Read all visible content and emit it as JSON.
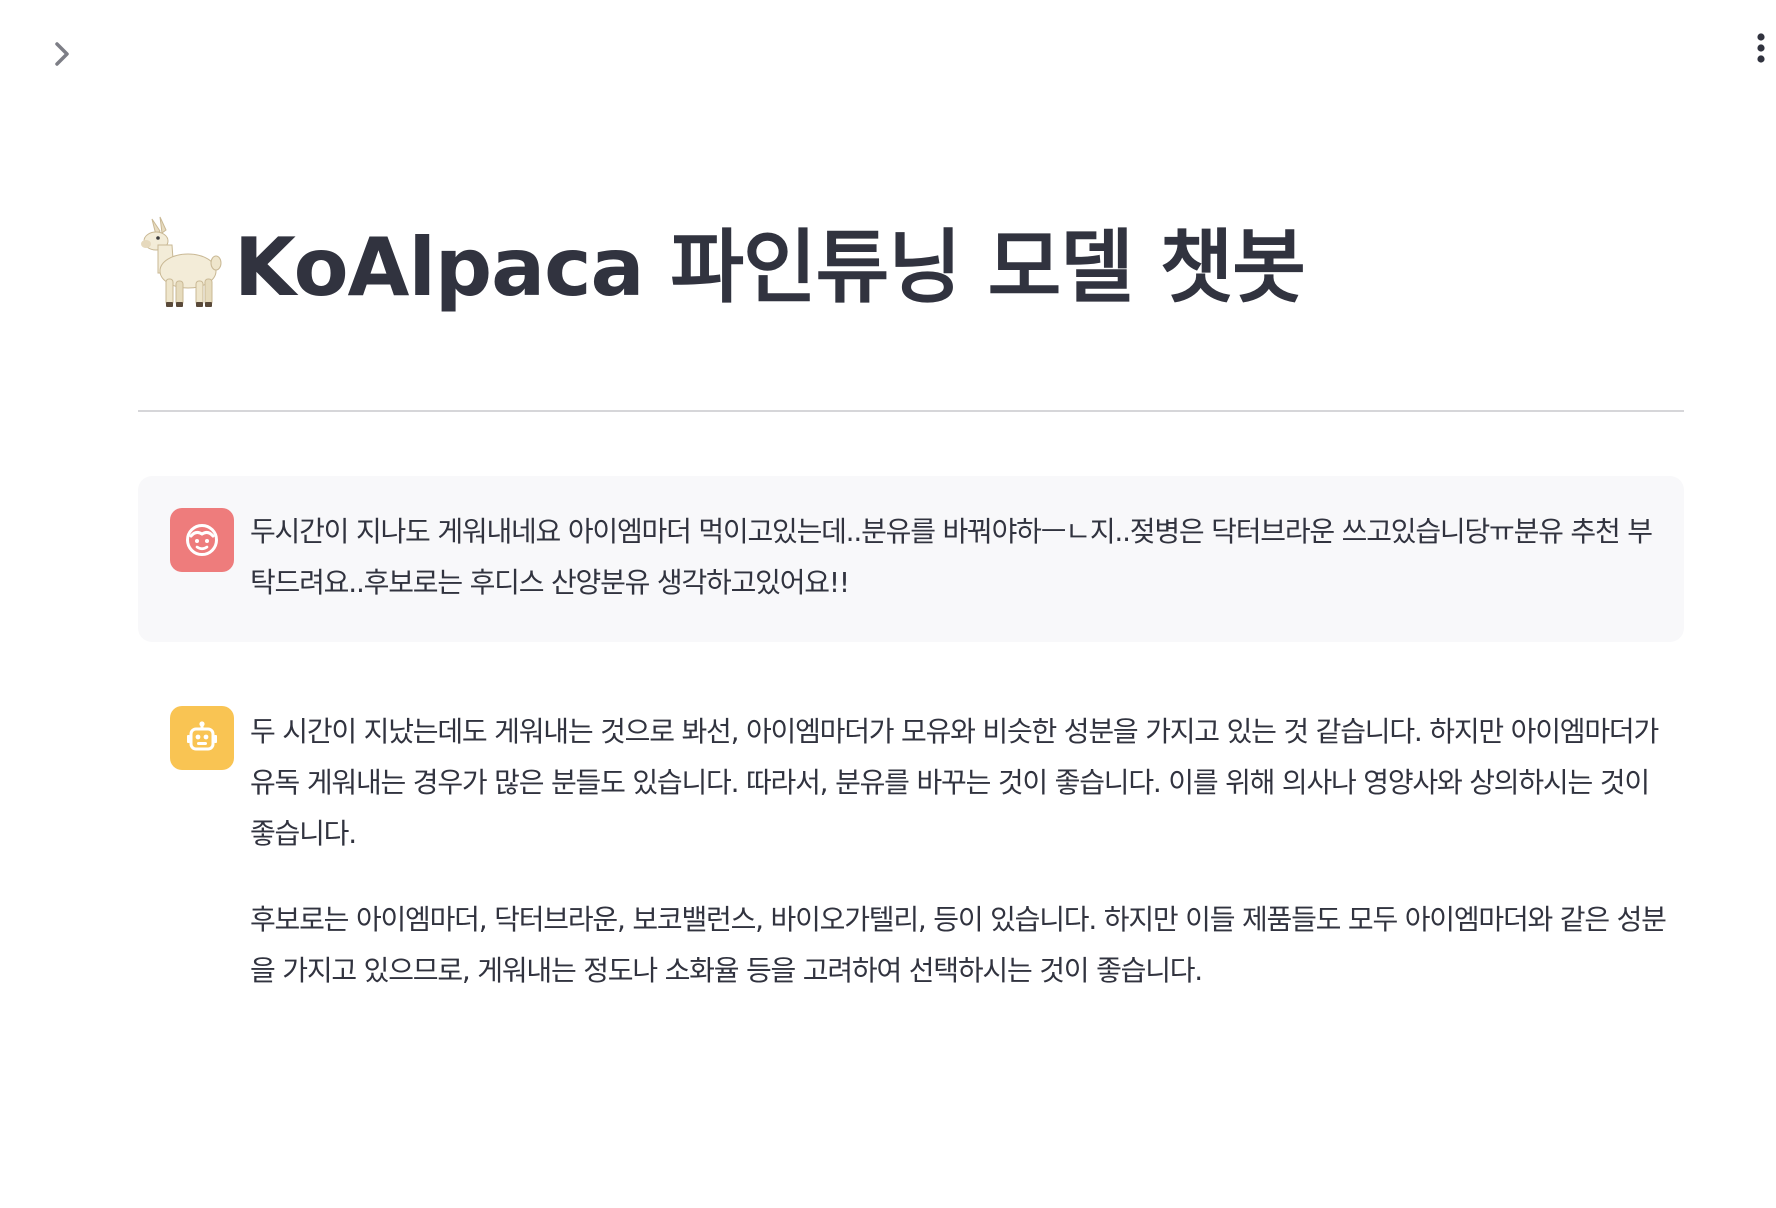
{
  "app": {
    "title": "KoAlpaca 파인튜닝 모델 챗봇"
  },
  "header": {
    "sidebar_toggle_icon": "chevron-right-icon",
    "main_menu_icon": "vertical-ellipsis-icon"
  },
  "title_icon": "llama-emoji",
  "colors": {
    "user_avatar": "#ee7c7c",
    "assistant_avatar": "#f9c453",
    "user_bubble": "#f8f8fa",
    "text": "#31333f"
  },
  "messages": [
    {
      "role": "user",
      "avatar_icon": "face-icon",
      "paragraphs": [
        "두시간이 지나도 게워내네요 아이엠마더 먹이고있는데..분유를 바꿔야하ㅡㄴ지..젖병은 닥터브라운 쓰고있습니당ㅠ분유 추천 부탁드려요..후보로는 후디스 산양분유 생각하고있어요!!"
      ]
    },
    {
      "role": "assistant",
      "avatar_icon": "robot-icon",
      "paragraphs": [
        "두 시간이 지났는데도 게워내는 것으로 봐선, 아이엠마더가 모유와 비슷한 성분을 가지고 있는 것 같습니다. 하지만 아이엠마더가 유독 게워내는 경우가 많은 분들도 있습니다. 따라서, 분유를 바꾸는 것이 좋습니다. 이를 위해 의사나 영양사와 상의하시는 것이 좋습니다.",
        "후보로는 아이엠마더, 닥터브라운, 보코밸런스, 바이오가텔리, 등이 있습니다. 하지만 이들 제품들도 모두 아이엠마더와 같은 성분을 가지고 있으므로, 게워내는 정도나 소화율 등을 고려하여 선택하시는 것이 좋습니다."
      ]
    }
  ]
}
